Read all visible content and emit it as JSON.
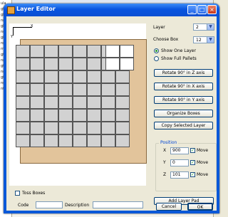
{
  "window": {
    "title": "Layer Editor",
    "minimize": "_",
    "maximize": "□",
    "close": "×"
  },
  "canvas": {
    "axis_y_label": "Y",
    "axis_x_label": "X"
  },
  "layer": {
    "label": "Layer",
    "value": "2"
  },
  "choose_box": {
    "label": "Choose Box",
    "value": "12"
  },
  "view_options": [
    {
      "label": "Show One Layer",
      "selected": true
    },
    {
      "label": "Show Full Pallets",
      "selected": false
    }
  ],
  "buttons": {
    "rotate_z": "Rotate 90° in Z axis",
    "rotate_x": "Rotate 90° in X axis",
    "rotate_y": "Rotate 90° in Y axis",
    "organize": "Organize Boxes",
    "copy_layer": "Copy Selected Layer",
    "add_layer_pad": "Add Layer Pad",
    "cancel": "Cancel",
    "ok": "OK"
  },
  "position": {
    "title": "Position",
    "x": {
      "label": "X",
      "value": "900",
      "move_label": "Move",
      "move_checked": true
    },
    "y": {
      "label": "Y",
      "value": "0",
      "move_label": "Move",
      "move_checked": true
    },
    "z": {
      "label": "Z",
      "value": "101",
      "move_label": "Move",
      "move_checked": true
    }
  },
  "toss_boxes": {
    "label": "Toss Boxes",
    "checked": false
  },
  "code": {
    "label": "Code",
    "value": ""
  },
  "description": {
    "label": "Description",
    "value": ""
  },
  "background_left_lines": [
    "ula",
    "gt",
    "gh",
    "ngth",
    "gh",
    "ngth",
    "gh",
    "ngth",
    "rma",
    "gt",
    "ngth",
    "gth",
    "ngth",
    "gt",
    "ngth",
    "nt"
  ]
}
